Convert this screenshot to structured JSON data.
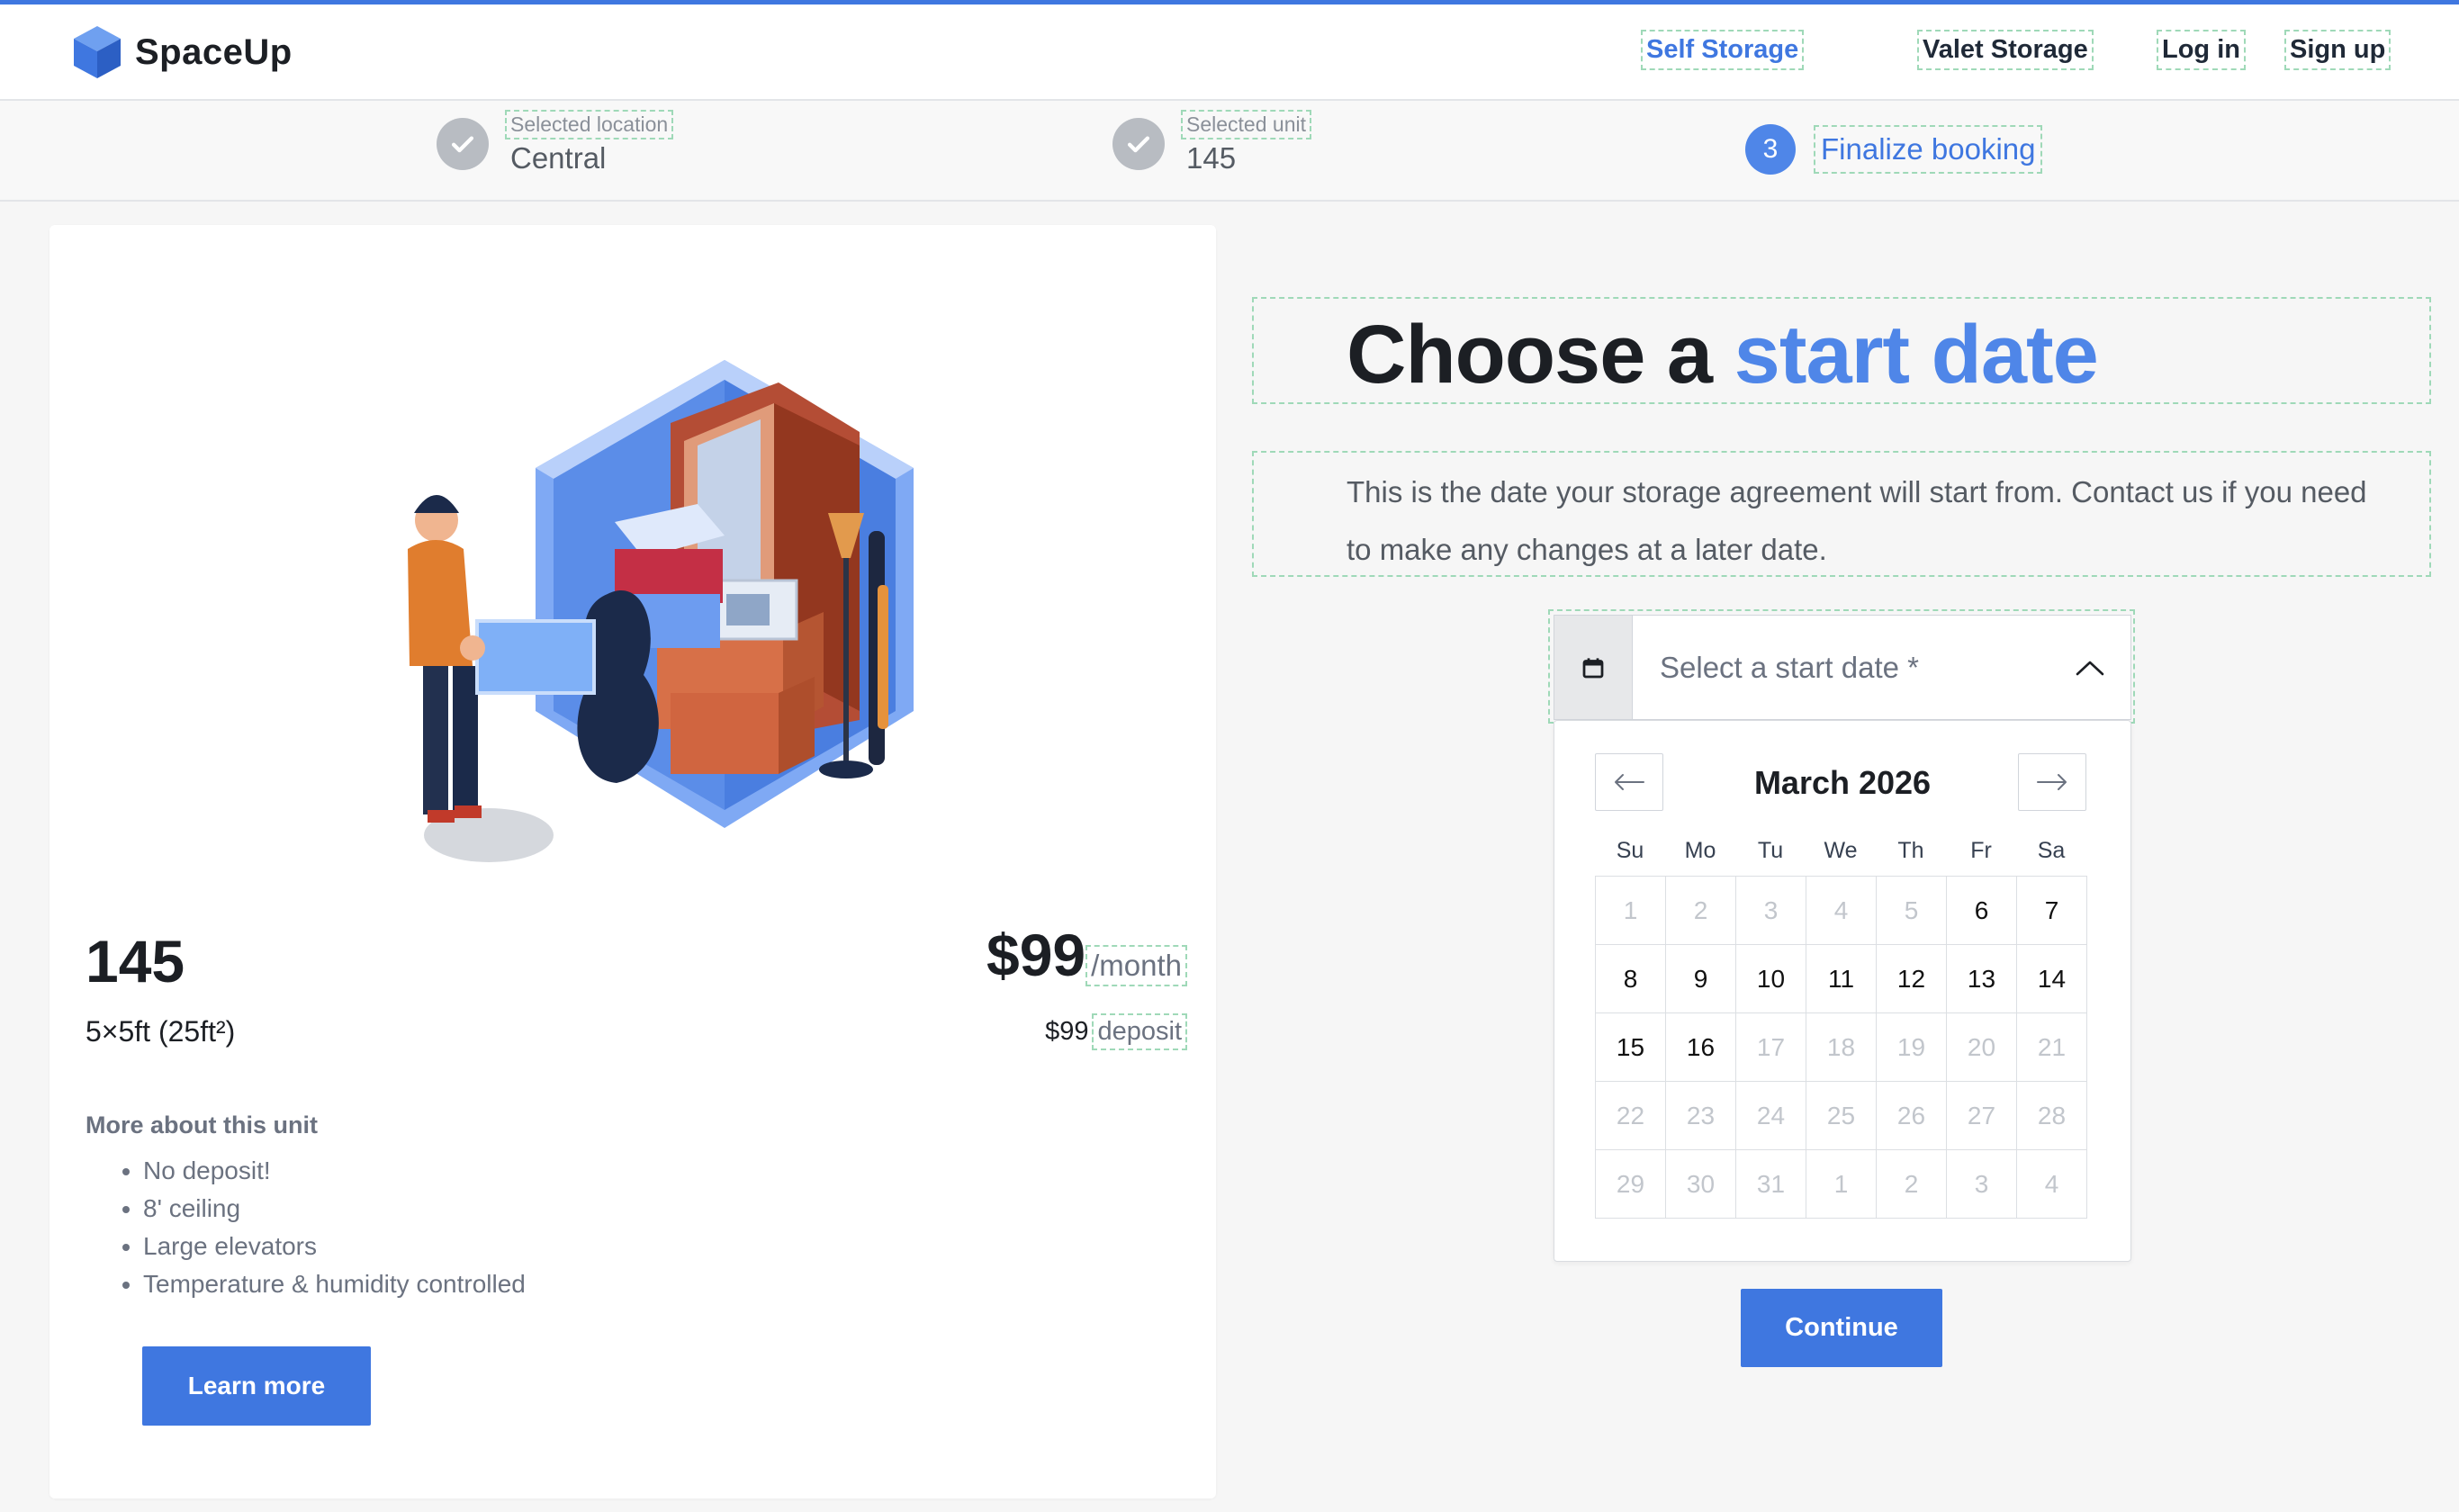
{
  "brand": {
    "name": "SpaceUp",
    "accent_color": "#3f77e0"
  },
  "nav": {
    "self_storage": "Self Storage",
    "valet_storage": "Valet Storage",
    "log_in": "Log in",
    "sign_up": "Sign up"
  },
  "stepper": {
    "step1": {
      "label": "Selected location",
      "value": "Central",
      "status": "complete"
    },
    "step2": {
      "label": "Selected unit",
      "value": "145",
      "status": "complete"
    },
    "step3": {
      "number": "3",
      "label": "Finalize booking",
      "status": "current"
    }
  },
  "unit": {
    "name": "145",
    "size": "5×5ft (25ft²)",
    "price": "$99",
    "price_suffix": "/month",
    "deposit_amount": "$99",
    "deposit_label": "deposit",
    "more_title": "More about this unit",
    "features": [
      "No deposit!",
      "8' ceiling",
      "Large elevators",
      "Temperature & humidity controlled"
    ],
    "learn_more": "Learn more"
  },
  "booking": {
    "title_prefix": "Choose a",
    "title_accent": "start date",
    "description": "This is the date your storage agreement will start from. Contact us if you need to make any changes at a later date.",
    "date_placeholder": "Select a start date *"
  },
  "calendar": {
    "month_label": "March 2026",
    "weekdays": [
      "Su",
      "Mo",
      "Tu",
      "We",
      "Th",
      "Fr",
      "Sa"
    ],
    "days": [
      {
        "d": "1",
        "enabled": false
      },
      {
        "d": "2",
        "enabled": false
      },
      {
        "d": "3",
        "enabled": false
      },
      {
        "d": "4",
        "enabled": false
      },
      {
        "d": "5",
        "enabled": false
      },
      {
        "d": "6",
        "enabled": true
      },
      {
        "d": "7",
        "enabled": true
      },
      {
        "d": "8",
        "enabled": true
      },
      {
        "d": "9",
        "enabled": true
      },
      {
        "d": "10",
        "enabled": true
      },
      {
        "d": "11",
        "enabled": true
      },
      {
        "d": "12",
        "enabled": true
      },
      {
        "d": "13",
        "enabled": true
      },
      {
        "d": "14",
        "enabled": true
      },
      {
        "d": "15",
        "enabled": true
      },
      {
        "d": "16",
        "enabled": true
      },
      {
        "d": "17",
        "enabled": false
      },
      {
        "d": "18",
        "enabled": false
      },
      {
        "d": "19",
        "enabled": false
      },
      {
        "d": "20",
        "enabled": false
      },
      {
        "d": "21",
        "enabled": false
      },
      {
        "d": "22",
        "enabled": false
      },
      {
        "d": "23",
        "enabled": false
      },
      {
        "d": "24",
        "enabled": false
      },
      {
        "d": "25",
        "enabled": false
      },
      {
        "d": "26",
        "enabled": false
      },
      {
        "d": "27",
        "enabled": false
      },
      {
        "d": "28",
        "enabled": false
      },
      {
        "d": "29",
        "enabled": false
      },
      {
        "d": "30",
        "enabled": false
      },
      {
        "d": "31",
        "enabled": false
      },
      {
        "d": "1",
        "enabled": false
      },
      {
        "d": "2",
        "enabled": false
      },
      {
        "d": "3",
        "enabled": false
      },
      {
        "d": "4",
        "enabled": false
      }
    ]
  },
  "actions": {
    "continue": "Continue"
  },
  "icons": {
    "logo": "cube-logo-icon",
    "check": "check-icon",
    "calendar": "calendar-icon",
    "chevron": "chevron-up-icon",
    "prev": "arrow-left-icon",
    "next": "arrow-right-icon"
  }
}
